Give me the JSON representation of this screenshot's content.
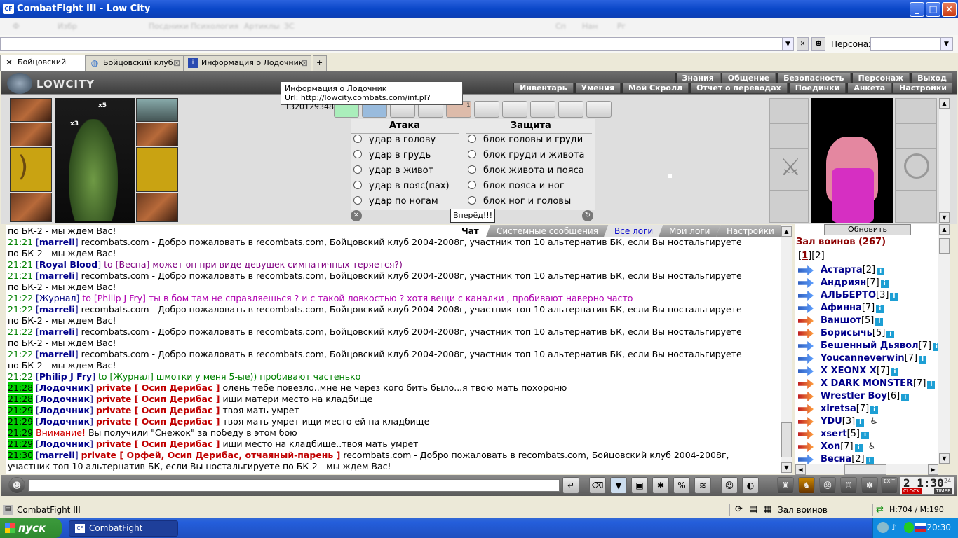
{
  "window": {
    "title": "CombatFight III - Low City",
    "icon": "CF"
  },
  "menu": {
    "blurred_items": [
      "Ф",
      "Избр",
      "Посдники",
      "Психология",
      "Артиклы",
      "ЗС",
      "Сп",
      "Нан",
      "Рг"
    ]
  },
  "toolbar": {
    "persona_label": "Персонаж:"
  },
  "tabs": [
    {
      "label": "Бойцовский клуб",
      "icon": "crossed-swords-icon"
    },
    {
      "label": "Бойцовский клуб.",
      "icon": "globe-icon"
    },
    {
      "label": "Информация о Лодочник",
      "icon": "info-icon"
    }
  ],
  "game": {
    "logo": "LOWCITY",
    "nav_top": [
      "Знания",
      "Общение",
      "Безопасность",
      "Персонаж",
      "Выход"
    ],
    "nav_bottom": [
      "Инвентарь",
      "Умения",
      "Мой Скролл",
      "Отчет о переводах",
      "Поединки",
      "Анкета",
      "Настройки"
    ],
    "tooltip": {
      "line1": "Информация о Лодочник",
      "line2": "Url: http://lowcity.combats.com/inf.pl?1320129348"
    },
    "slot_badges": [
      "x5",
      "x3"
    ],
    "scroll_badge": "1",
    "attack_title": "Атака",
    "defense_title": "Защита",
    "attack": [
      "удар в голову",
      "удар в грудь",
      "удар в живот",
      "удар в пояс(пах)",
      "удар по ногам"
    ],
    "defense": [
      "блок головы и груди",
      "блок груди и живота",
      "блок живота и пояса",
      "блок пояса и ног",
      "блок ног и головы"
    ],
    "forward": "Вперёд!!!"
  },
  "chat_tabs": [
    "Чат",
    "Системные сообщения",
    "Все логи",
    "Мои логи",
    "Настройки"
  ],
  "chat": [
    {
      "parts": [
        [
          "",
          "по БК-2 - мы ждем Вас!"
        ]
      ]
    },
    {
      "parts": [
        [
          "tm",
          "21:21"
        ],
        [
          "nk",
          " ["
        ],
        [
          "nm",
          "marreli"
        ],
        [
          "nk",
          "] "
        ],
        [
          "",
          "recombats.com - Добро пожаловать в recombats.com, Бойцовский клуб 2004-2008г, участник топ 10 альтернатив БК, если Вы ностальгируете"
        ]
      ]
    },
    {
      "parts": [
        [
          "",
          "по БК-2 - мы ждем Вас!"
        ]
      ]
    },
    {
      "parts": [
        [
          "tm",
          "21:21"
        ],
        [
          "nk",
          " ["
        ],
        [
          "nm",
          "Royal Blood"
        ],
        [
          "nk",
          "] "
        ],
        [
          "to",
          "to [Весна] может он при виде девушек симпатичных теряется?)"
        ]
      ]
    },
    {
      "parts": [
        [
          "tm",
          "21:21"
        ],
        [
          "nk",
          " ["
        ],
        [
          "nm",
          "marreli"
        ],
        [
          "nk",
          "] "
        ],
        [
          "",
          "recombats.com - Добро пожаловать в recombats.com, Бойцовский клуб 2004-2008г, участник топ 10 альтернатив БК, если Вы ностальгируете"
        ]
      ]
    },
    {
      "parts": [
        [
          "",
          "по БК-2 - мы ждем Вас!"
        ]
      ]
    },
    {
      "parts": [
        [
          "tm",
          "21:22"
        ],
        [
          "nk",
          " ["
        ],
        [
          "nk",
          "Журнал"
        ],
        [
          "nk",
          "] "
        ],
        [
          "tj",
          "to [Philip J Fry] ты в бом там не справляешься ? и с такой ловкостью ? хотя вещи с каналки , пробивают наверно часто"
        ]
      ]
    },
    {
      "parts": [
        [
          "tm",
          "21:22"
        ],
        [
          "nk",
          " ["
        ],
        [
          "nm",
          "marreli"
        ],
        [
          "nk",
          "] "
        ],
        [
          "",
          "recombats.com - Добро пожаловать в recombats.com, Бойцовский клуб 2004-2008г, участник топ 10 альтернатив БК, если Вы ностальгируете"
        ]
      ]
    },
    {
      "parts": [
        [
          "",
          "по БК-2 - мы ждем Вас!"
        ]
      ]
    },
    {
      "parts": [
        [
          "tm",
          "21:22"
        ],
        [
          "nk",
          " ["
        ],
        [
          "nm",
          "marreli"
        ],
        [
          "nk",
          "] "
        ],
        [
          "",
          "recombats.com - Добро пожаловать в recombats.com, Бойцовский клуб 2004-2008г, участник топ 10 альтернатив БК, если Вы ностальгируете"
        ]
      ]
    },
    {
      "parts": [
        [
          "",
          "по БК-2 - мы ждем Вас!"
        ]
      ]
    },
    {
      "parts": [
        [
          "tm",
          "21:22"
        ],
        [
          "nk",
          " ["
        ],
        [
          "nm",
          "marreli"
        ],
        [
          "nk",
          "] "
        ],
        [
          "",
          "recombats.com - Добро пожаловать в recombats.com, Бойцовский клуб 2004-2008г, участник топ 10 альтернатив БК, если Вы ностальгируете"
        ]
      ]
    },
    {
      "parts": [
        [
          "",
          "по БК-2 - мы ждем Вас!"
        ]
      ]
    },
    {
      "parts": [
        [
          "tm",
          "21:22"
        ],
        [
          "nk",
          " ["
        ],
        [
          "nm",
          "Philip J Fry"
        ],
        [
          "nk",
          "] "
        ],
        [
          "gr",
          "to [Журнал] шмотки у меня 5-ые)) пробивают частенько"
        ]
      ]
    },
    {
      "parts": [
        [
          "tm hl",
          "21:28"
        ],
        [
          "nk",
          " ["
        ],
        [
          "nm",
          "Лодочник"
        ],
        [
          "nk",
          "] "
        ],
        [
          "pv",
          "private [ Осип Дерибас ]"
        ],
        [
          "",
          " олень тебе повезло..мне не через кого бить было...я твою мать похороню"
        ]
      ]
    },
    {
      "parts": [
        [
          "tm hl",
          "21:28"
        ],
        [
          "nk",
          " ["
        ],
        [
          "nm",
          "Лодочник"
        ],
        [
          "nk",
          "] "
        ],
        [
          "pv",
          "private [ Осип Дерибас ]"
        ],
        [
          "",
          " ищи матери место на кладбище"
        ]
      ]
    },
    {
      "parts": [
        [
          "tm hl",
          "21:29"
        ],
        [
          "nk",
          " ["
        ],
        [
          "nm",
          "Лодочник"
        ],
        [
          "nk",
          "] "
        ],
        [
          "pv",
          "private [ Осип Дерибас ]"
        ],
        [
          "",
          " твоя мать умрет"
        ]
      ]
    },
    {
      "parts": [
        [
          "tm hl",
          "21:29"
        ],
        [
          "nk",
          " ["
        ],
        [
          "nm",
          "Лодочник"
        ],
        [
          "nk",
          "] "
        ],
        [
          "pv",
          "private [ Осип Дерибас ]"
        ],
        [
          "",
          " твоя мать умрет ищи место ей на кладбище"
        ]
      ]
    },
    {
      "parts": [
        [
          "tm hl",
          "21:29"
        ],
        [
          "wn",
          " Внимание!"
        ],
        [
          "",
          " Вы получили \"Снежок\" за победу в этом бою"
        ]
      ]
    },
    {
      "parts": [
        [
          "tm hl",
          "21:29"
        ],
        [
          "nk",
          " ["
        ],
        [
          "nm",
          "Лодочник"
        ],
        [
          "nk",
          "] "
        ],
        [
          "pv",
          "private [ Осип Дерибас ]"
        ],
        [
          "",
          " ищи место на кладбище..твоя мать умрет"
        ]
      ]
    },
    {
      "parts": [
        [
          "tm hl",
          "21:30"
        ],
        [
          "nk",
          " ["
        ],
        [
          "nm",
          "marreli"
        ],
        [
          "nk",
          "] "
        ],
        [
          "pv",
          "private [ Орфей, Осип Дерибас, отчаяный-парень ]"
        ],
        [
          "",
          " recombats.com - Добро пожаловать в recombats.com, Бойцовский клуб 2004-2008г,"
        ]
      ]
    },
    {
      "parts": [
        [
          "",
          "участник топ 10 альтернатив БК, если Вы ностальгируете по БК-2 - мы ждем Вас!"
        ]
      ]
    }
  ],
  "right_panel": {
    "refresh": "Обновить",
    "title": "Зал воинов (267)",
    "pages": [
      "1",
      "2"
    ],
    "players": [
      {
        "name": "Астарта",
        "level": "[2]",
        "red": false,
        "extra": false
      },
      {
        "name": "Андриян",
        "level": "[7]",
        "red": false,
        "extra": false
      },
      {
        "name": "АЛЬБЕРТО",
        "level": "[3]",
        "red": false,
        "extra": false
      },
      {
        "name": "Афинна",
        "level": "[7]",
        "red": false,
        "extra": false
      },
      {
        "name": "Ваншот",
        "level": "[5]",
        "red": true,
        "extra": false
      },
      {
        "name": "Борисычь",
        "level": "[5]",
        "red": true,
        "extra": false
      },
      {
        "name": "Бешенный Дьявол",
        "level": "[7]",
        "red": false,
        "extra": false
      },
      {
        "name": "Youcanneverwin",
        "level": "[7]",
        "red": false,
        "extra": false
      },
      {
        "name": "X XEONX X",
        "level": "[7]",
        "red": false,
        "extra": false
      },
      {
        "name": "X DARK MONSTER",
        "level": "[7]",
        "red": true,
        "extra": false
      },
      {
        "name": "Wrestler Boy",
        "level": "[6]",
        "red": true,
        "extra": false
      },
      {
        "name": "xiretsa",
        "level": "[7]",
        "red": true,
        "extra": false
      },
      {
        "name": "YDU",
        "level": "[3]",
        "red": true,
        "extra": true
      },
      {
        "name": "xsert",
        "level": "[5]",
        "red": true,
        "extra": false
      },
      {
        "name": "Xon",
        "level": "[7]",
        "red": true,
        "extra": true
      },
      {
        "name": "Весна",
        "level": "[2]",
        "red": false,
        "extra": false
      }
    ]
  },
  "clock": {
    "time": "2 1:30",
    "sec": "24",
    "clock_label": "CLOCK",
    "timer_label": "TIMER",
    "exit": "EXIT"
  },
  "statusbar": {
    "app": "CombatFight III",
    "location": "Зал воинов",
    "dims": "H:704 / M:190"
  },
  "taskbar": {
    "start": "пуск",
    "app": "CombatFight",
    "time": "20:30"
  }
}
